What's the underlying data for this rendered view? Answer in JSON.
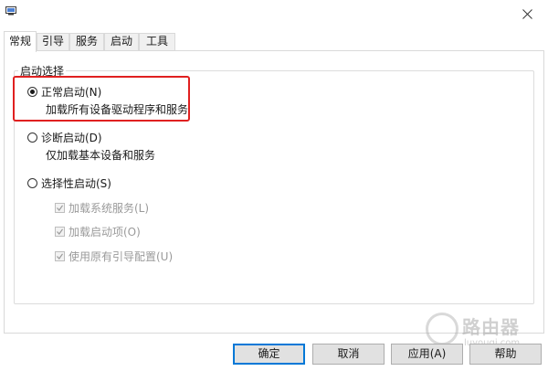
{
  "tabs": [
    {
      "label": "常规"
    },
    {
      "label": "引导"
    },
    {
      "label": "服务"
    },
    {
      "label": "启动"
    },
    {
      "label": "工具"
    }
  ],
  "group_title": "启动选择",
  "options": [
    {
      "label": "正常启动(N)",
      "description": "加载所有设备驱动程序和服务",
      "checked": true
    },
    {
      "label": "诊断启动(D)",
      "description": "仅加载基本设备和服务",
      "checked": false
    },
    {
      "label": "选择性启动(S)",
      "checked": false
    }
  ],
  "checkboxes": [
    {
      "label": "加载系统服务(L)",
      "checked": true,
      "enabled": false
    },
    {
      "label": "加载启动项(O)",
      "checked": true,
      "enabled": false
    },
    {
      "label": "使用原有引导配置(U)",
      "checked": true,
      "enabled": false
    }
  ],
  "buttons": {
    "ok": "确定",
    "cancel": "取消",
    "apply": "应用(A)",
    "help": "帮助"
  },
  "watermark": {
    "title": "路由器",
    "subtitle": "luyouqi.com"
  },
  "colors": {
    "highlight": "#e02020",
    "accent": "#0078d7"
  }
}
